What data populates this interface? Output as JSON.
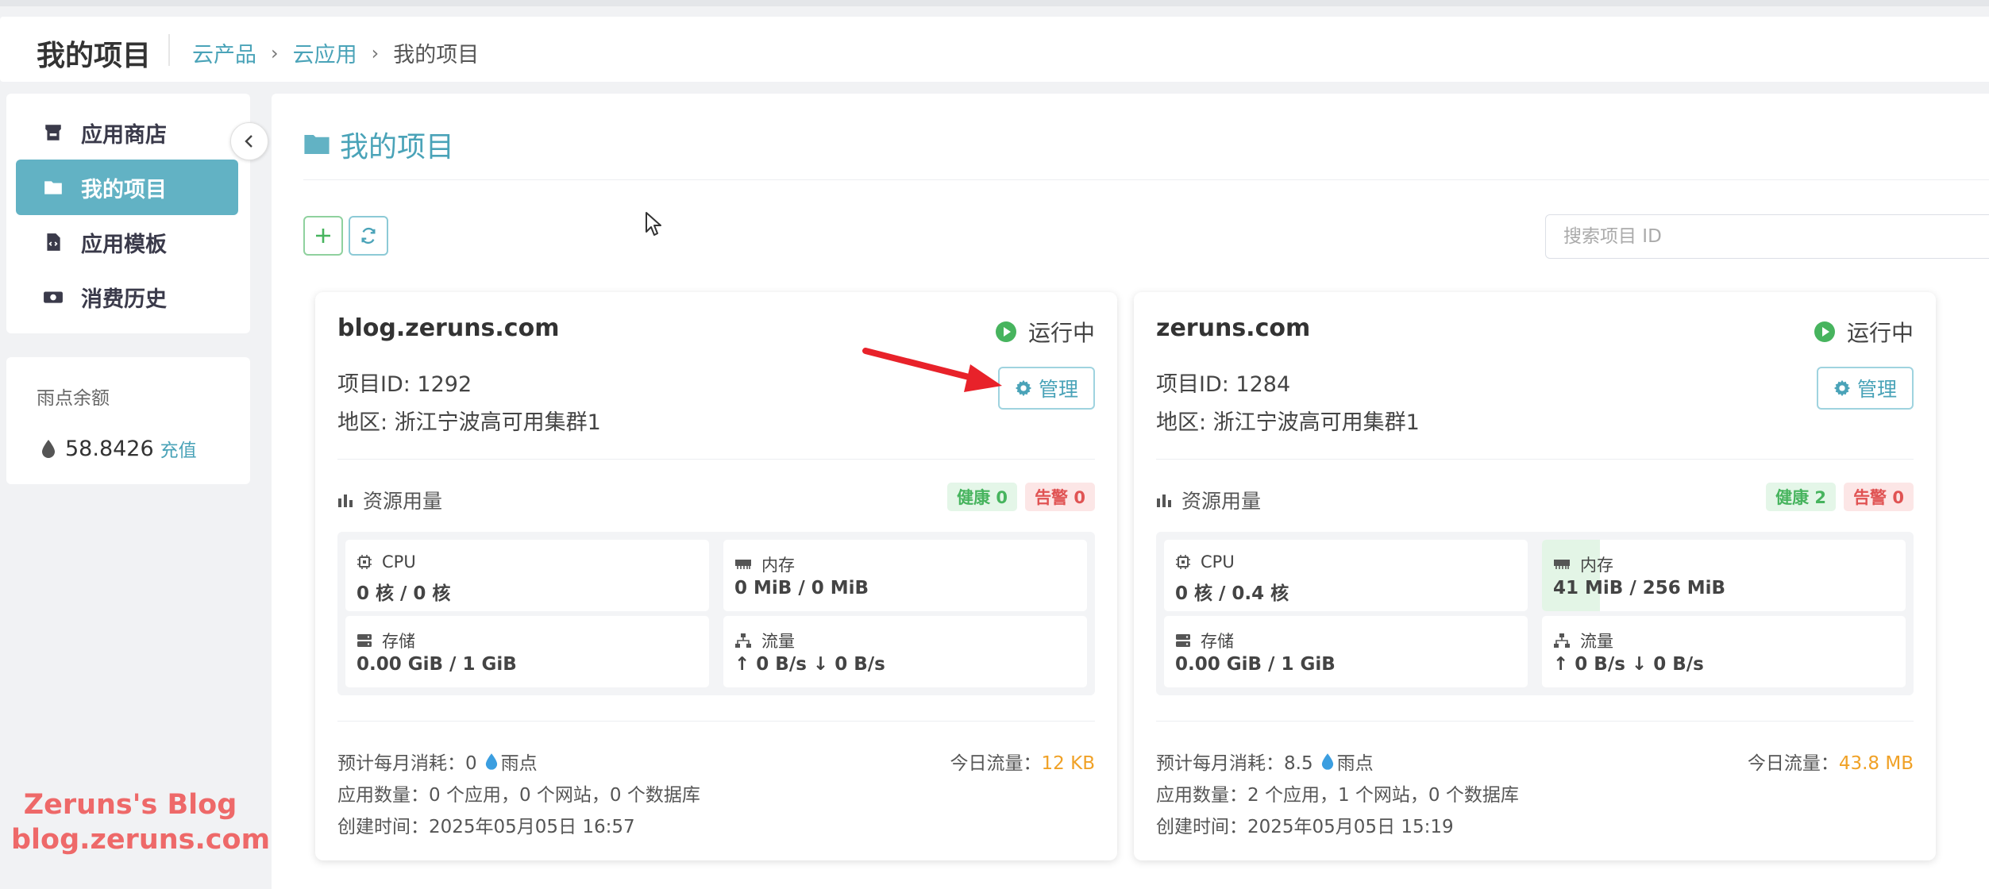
{
  "header": {
    "title": "我的项目",
    "breadcrumbs": [
      "云产品",
      "云应用",
      "我的项目"
    ]
  },
  "sidebar": {
    "items": [
      {
        "label": "应用商店",
        "icon": "store-icon"
      },
      {
        "label": "我的项目",
        "icon": "folder-icon",
        "active": true
      },
      {
        "label": "应用模板",
        "icon": "file-code-icon"
      },
      {
        "label": "消费历史",
        "icon": "money-icon"
      }
    ],
    "balance": {
      "label": "雨点余额",
      "value": "58.8426",
      "recharge": "充值"
    }
  },
  "main": {
    "title": "我的项目",
    "search_placeholder": "搜索项目 ID"
  },
  "projects": [
    {
      "name": "blog.zeruns.com",
      "status": "运行中",
      "project_id": "项目ID: 1292",
      "region": "地区: 浙江宁波高可用集群1",
      "manage_label": "管理",
      "resource_label": "资源用量",
      "healthy": "健康 0",
      "alerts": "告警 0",
      "cpu_label": "CPU",
      "cpu_value": "0 核 / 0 核",
      "mem_label": "内存",
      "mem_value": "0 MiB / 0 MiB",
      "mem_usage_fraction": 0,
      "storage_label": "存储",
      "storage_value": "0.00 GiB / 1 GiB",
      "net_label": "流量",
      "net_value": "↑ 0 B/s ↓ 0 B/s",
      "cost_prefix": "预计每月消耗：0",
      "cost_unit": "雨点",
      "traffic_label": "今日流量：",
      "traffic_value": "12 KB",
      "apps": "应用数量：0 个应用，0 个网站，0 个数据库",
      "created": "创建时间：2025年05月05日 16:57"
    },
    {
      "name": "zeruns.com",
      "status": "运行中",
      "project_id": "项目ID: 1284",
      "region": "地区: 浙江宁波高可用集群1",
      "manage_label": "管理",
      "resource_label": "资源用量",
      "healthy": "健康 2",
      "alerts": "告警 0",
      "cpu_label": "CPU",
      "cpu_value": "0 核 / 0.4 核",
      "mem_label": "内存",
      "mem_value": "41 MiB / 256 MiB",
      "mem_usage_fraction": 0.16,
      "storage_label": "存储",
      "storage_value": "0.00 GiB / 1 GiB",
      "net_label": "流量",
      "net_value": "↑ 0 B/s ↓ 0 B/s",
      "cost_prefix": "预计每月消耗：8.5",
      "cost_unit": "雨点",
      "traffic_label": "今日流量：",
      "traffic_value": "43.8 MB",
      "apps": "应用数量：2 个应用，1 个网站，0 个数据库",
      "created": "创建时间：2025年05月05日 15:19"
    }
  ],
  "watermark": {
    "line1": "Zeruns's Blog",
    "line2": "blog.zeruns.com"
  },
  "colors": {
    "accent": "#62b2c4",
    "link": "#4aa3b8",
    "success": "#47b45e",
    "danger": "#e05353",
    "warning": "#f0a126",
    "annotation_arrow": "#e8222a"
  }
}
